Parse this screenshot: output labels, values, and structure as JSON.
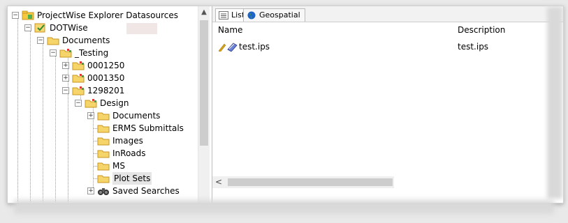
{
  "tree": {
    "root": "ProjectWise Explorer Datasources",
    "datasource": "DOTWise",
    "documents": "Documents",
    "testing": "_Testing",
    "p1": "0001250",
    "p2": "0001350",
    "p3": "1298201",
    "design": "Design",
    "d_documents": "Documents",
    "ermss": "ERMS Submittals",
    "images": "Images",
    "inroads": "InRoads",
    "ms": "MS",
    "plotsets": "Plot Sets",
    "saved": "Saved Searches"
  },
  "tabs": {
    "list": "List",
    "geo": "Geospatial"
  },
  "list": {
    "col_name": "Name",
    "col_desc": "Description",
    "row_name": "test.ips",
    "row_desc": "test.ips"
  },
  "icons": {
    "folder": "folder-icon",
    "project": "project-folder-icon",
    "datasource": "datasource-icon",
    "binoculars": "binoculars-icon",
    "globe": "globe-icon",
    "list": "list-icon",
    "pencil": "pencil-icon",
    "document": "document-icon"
  }
}
